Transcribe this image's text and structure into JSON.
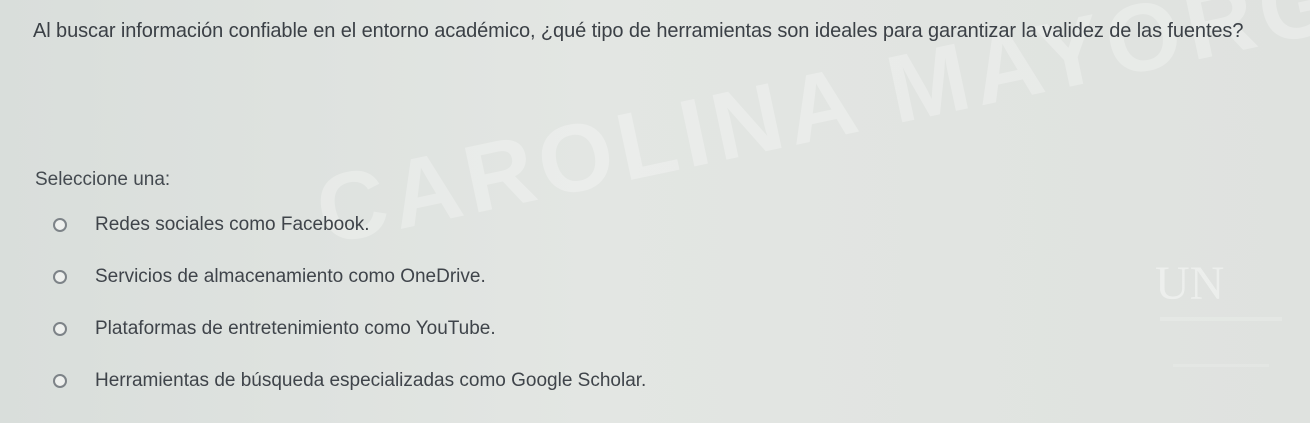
{
  "question": {
    "text": "Al buscar información confiable en el entorno académico, ¿qué tipo de herramientas son ideales para garantizar la validez de las fuentes?"
  },
  "prompt": {
    "label": "Seleccione una:"
  },
  "options": [
    {
      "label": "Redes sociales como Facebook."
    },
    {
      "label": "Servicios de almacenamiento como OneDrive."
    },
    {
      "label": "Plataformas de entretenimiento como YouTube."
    },
    {
      "label": "Herramientas de búsqueda especializadas como Google Scholar."
    }
  ],
  "watermark": {
    "text": "CAROLINA MAYORGA"
  },
  "logo": {
    "text": "UN"
  },
  "colors": {
    "background": "#e0e3e0",
    "text": "#3b4046",
    "watermark": "#ffffff"
  }
}
